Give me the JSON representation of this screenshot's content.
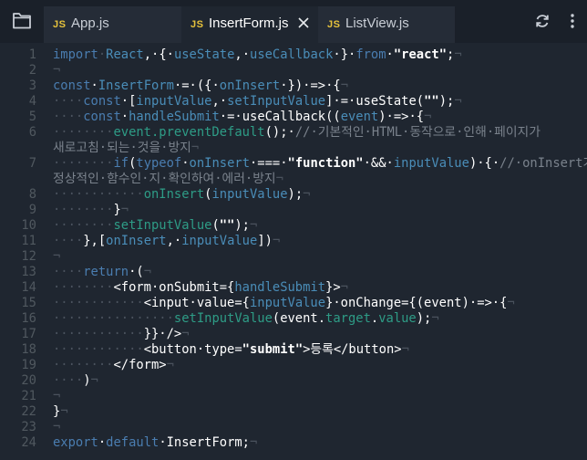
{
  "tabs": [
    {
      "badge": "JS",
      "name": "App.js"
    },
    {
      "badge": "JS",
      "name": "InsertForm.js"
    },
    {
      "badge": "JS",
      "name": "ListView.js"
    }
  ],
  "icons": {
    "folder": "folder-icon",
    "close": "close-icon",
    "refresh": "refresh-icon",
    "more": "more-vertical-icon"
  },
  "colors": {
    "background": "#1f2630",
    "keyword": "#4a7db0",
    "function": "#2e9c86",
    "jsBadge": "#e6c23c"
  },
  "lines": [
    {
      "n": "1",
      "t": [
        [
          "kw",
          "import"
        ],
        [
          "ws",
          "·"
        ],
        [
          "var",
          "React"
        ],
        [
          "wht",
          ",·{·"
        ],
        [
          "var",
          "useState"
        ],
        [
          "wht",
          ",·"
        ],
        [
          "var",
          "useCallback"
        ],
        [
          "wht",
          "·}·"
        ],
        [
          "kw",
          "from"
        ],
        [
          "wht",
          "·"
        ],
        [
          "str",
          "\"react\""
        ],
        [
          "wht",
          ";"
        ],
        [
          "ws",
          "¬"
        ]
      ]
    },
    {
      "n": "2",
      "t": [
        [
          "ws",
          "¬"
        ]
      ]
    },
    {
      "n": "3",
      "t": [
        [
          "kw",
          "const"
        ],
        [
          "wht",
          "·"
        ],
        [
          "var",
          "InsertForm"
        ],
        [
          "wht",
          "·=·({·"
        ],
        [
          "var",
          "onInsert"
        ],
        [
          "wht",
          "·})·=>·{"
        ],
        [
          "ws",
          "¬"
        ]
      ]
    },
    {
      "n": "4",
      "t": [
        [
          "ws",
          "····"
        ],
        [
          "kw",
          "const"
        ],
        [
          "wht",
          "·["
        ],
        [
          "var",
          "inputValue"
        ],
        [
          "wht",
          ",·"
        ],
        [
          "var",
          "setInputValue"
        ],
        [
          "wht",
          "]·=·useState("
        ],
        [
          "str",
          "\"\""
        ],
        [
          "wht",
          ");"
        ],
        [
          "ws",
          "¬"
        ]
      ]
    },
    {
      "n": "5",
      "t": [
        [
          "ws",
          "····"
        ],
        [
          "kw",
          "const"
        ],
        [
          "wht",
          "·"
        ],
        [
          "var",
          "handleSubmit"
        ],
        [
          "wht",
          "·=·useCallback(("
        ],
        [
          "var",
          "event"
        ],
        [
          "wht",
          ")·=>·{"
        ],
        [
          "ws",
          "¬"
        ]
      ]
    },
    {
      "n": "6",
      "t": [
        [
          "ws",
          "········"
        ],
        [
          "fn",
          "event.preventDefault"
        ],
        [
          "wht",
          "();·"
        ],
        [
          "cm",
          "//·기본적인·HTML·동작으로·인해·페이지가"
        ]
      ]
    },
    {
      "n": "",
      "t": [
        [
          "cm",
          "새로고침·되는·것을·방지"
        ],
        [
          "ws",
          "¬"
        ]
      ]
    },
    {
      "n": "7",
      "t": [
        [
          "ws",
          "········"
        ],
        [
          "kw",
          "if"
        ],
        [
          "wht",
          "("
        ],
        [
          "kw",
          "typeof"
        ],
        [
          "wht",
          "·"
        ],
        [
          "var",
          "onInsert"
        ],
        [
          "wht",
          "·===·"
        ],
        [
          "str",
          "\"function\""
        ],
        [
          "wht",
          "·&&·"
        ],
        [
          "var",
          "inputValue"
        ],
        [
          "wht",
          ")·{·"
        ],
        [
          "cm",
          "//·onInsert가"
        ]
      ]
    },
    {
      "n": "",
      "t": [
        [
          "cm",
          "정상적인·함수인·지·확인하여·에러·방지"
        ],
        [
          "ws",
          "¬"
        ]
      ]
    },
    {
      "n": "8",
      "t": [
        [
          "ws",
          "············"
        ],
        [
          "fn",
          "onInsert"
        ],
        [
          "wht",
          "("
        ],
        [
          "var",
          "inputValue"
        ],
        [
          "wht",
          ");"
        ],
        [
          "ws",
          "¬"
        ]
      ]
    },
    {
      "n": "9",
      "t": [
        [
          "ws",
          "········"
        ],
        [
          "wht",
          "}"
        ],
        [
          "ws",
          "¬"
        ]
      ]
    },
    {
      "n": "10",
      "t": [
        [
          "ws",
          "········"
        ],
        [
          "fn",
          "setInputValue"
        ],
        [
          "wht",
          "("
        ],
        [
          "str",
          "\"\""
        ],
        [
          "wht",
          ");"
        ],
        [
          "ws",
          "¬"
        ]
      ]
    },
    {
      "n": "11",
      "t": [
        [
          "ws",
          "····"
        ],
        [
          "wht",
          "},["
        ],
        [
          "var",
          "onInsert"
        ],
        [
          "wht",
          ",·"
        ],
        [
          "var",
          "inputValue"
        ],
        [
          "wht",
          "])"
        ],
        [
          "ws",
          "¬"
        ]
      ]
    },
    {
      "n": "12",
      "t": [
        [
          "ws",
          "¬"
        ]
      ]
    },
    {
      "n": "13",
      "t": [
        [
          "ws",
          "····"
        ],
        [
          "kw",
          "return"
        ],
        [
          "wht",
          "·("
        ],
        [
          "ws",
          "¬"
        ]
      ]
    },
    {
      "n": "14",
      "t": [
        [
          "ws",
          "········"
        ],
        [
          "wht",
          "<form·onSubmit={"
        ],
        [
          "var",
          "handleSubmit"
        ],
        [
          "wht",
          "}>"
        ],
        [
          "ws",
          "¬"
        ]
      ]
    },
    {
      "n": "15",
      "t": [
        [
          "ws",
          "············"
        ],
        [
          "wht",
          "<input·value={"
        ],
        [
          "var",
          "inputValue"
        ],
        [
          "wht",
          "}·onChange={(event)·=>·{"
        ],
        [
          "ws",
          "¬"
        ]
      ]
    },
    {
      "n": "16",
      "t": [
        [
          "ws",
          "················"
        ],
        [
          "fn",
          "setInputValue"
        ],
        [
          "wht",
          "(event."
        ],
        [
          "fn",
          "target"
        ],
        [
          "wht",
          "."
        ],
        [
          "fn",
          "value"
        ],
        [
          "wht",
          ");"
        ],
        [
          "ws",
          "¬"
        ]
      ]
    },
    {
      "n": "17",
      "t": [
        [
          "ws",
          "············"
        ],
        [
          "wht",
          "}}·/>"
        ],
        [
          "ws",
          "¬"
        ]
      ]
    },
    {
      "n": "18",
      "t": [
        [
          "ws",
          "············"
        ],
        [
          "wht",
          "<button·type="
        ],
        [
          "str",
          "\"submit\""
        ],
        [
          "wht",
          ">등록</button>"
        ],
        [
          "ws",
          "¬"
        ]
      ]
    },
    {
      "n": "19",
      "t": [
        [
          "ws",
          "········"
        ],
        [
          "wht",
          "</form>"
        ],
        [
          "ws",
          "¬"
        ]
      ]
    },
    {
      "n": "20",
      "t": [
        [
          "ws",
          "····"
        ],
        [
          "wht",
          ")"
        ],
        [
          "ws",
          "¬"
        ]
      ]
    },
    {
      "n": "21",
      "t": [
        [
          "ws",
          "¬"
        ]
      ]
    },
    {
      "n": "22",
      "t": [
        [
          "wht",
          "}"
        ],
        [
          "ws",
          "¬"
        ]
      ]
    },
    {
      "n": "23",
      "t": [
        [
          "ws",
          "¬"
        ]
      ]
    },
    {
      "n": "24",
      "t": [
        [
          "kw",
          "export"
        ],
        [
          "wht",
          "·"
        ],
        [
          "kw",
          "default"
        ],
        [
          "wht",
          "·InsertForm;"
        ],
        [
          "ws",
          "¬"
        ]
      ]
    }
  ]
}
